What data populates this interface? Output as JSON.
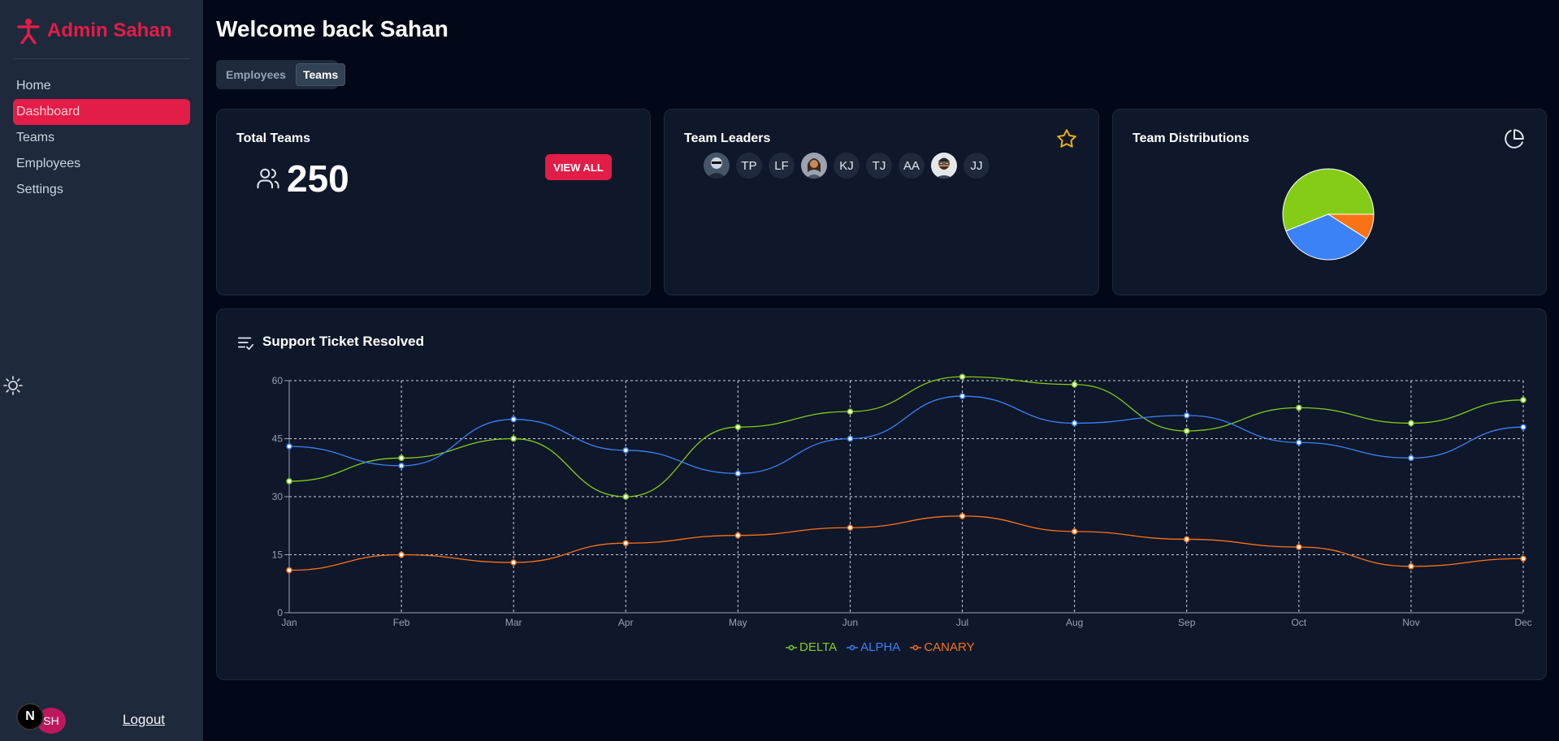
{
  "app": {
    "brand": "Admin Sahan",
    "page_title": "Welcome back Sahan"
  },
  "sidebar": {
    "items": [
      {
        "label": "Home",
        "active": false
      },
      {
        "label": "Dashboard",
        "active": true
      },
      {
        "label": "Teams",
        "active": false
      },
      {
        "label": "Employees",
        "active": false
      },
      {
        "label": "Settings",
        "active": false
      }
    ],
    "logout_label": "Logout",
    "next_badge": "N",
    "user_initials": "SH"
  },
  "tabs": [
    {
      "label": "Employees",
      "active": false
    },
    {
      "label": "Teams",
      "active": true
    }
  ],
  "cards": {
    "total_teams": {
      "title": "Total Teams",
      "value": "250",
      "button": "VIEW ALL"
    },
    "team_leaders": {
      "title": "Team Leaders",
      "avatars": [
        {
          "type": "photo",
          "label": ""
        },
        {
          "type": "initials",
          "label": "TP"
        },
        {
          "type": "initials",
          "label": "LF"
        },
        {
          "type": "photo",
          "label": ""
        },
        {
          "type": "initials",
          "label": "KJ"
        },
        {
          "type": "initials",
          "label": "TJ"
        },
        {
          "type": "initials",
          "label": "AA"
        },
        {
          "type": "photo",
          "label": ""
        },
        {
          "type": "initials",
          "label": "JJ"
        }
      ]
    },
    "team_distributions": {
      "title": "Team Distributions"
    },
    "support_tickets": {
      "title": "Support Ticket Resolved"
    }
  },
  "colors": {
    "accent": "#e11d48",
    "delta": "#84cc16",
    "alpha": "#3b82f6",
    "canary": "#f97316"
  },
  "chart_data": [
    {
      "type": "pie",
      "title": "",
      "series": [
        {
          "name": "DELTA",
          "value": 56
        },
        {
          "name": "ALPHA",
          "value": 35
        },
        {
          "name": "CANARY",
          "value": 9
        }
      ]
    },
    {
      "type": "line",
      "title": "",
      "categories": [
        "Jan",
        "Feb",
        "Mar",
        "Apr",
        "May",
        "Jun",
        "Jul",
        "Aug",
        "Sep",
        "Oct",
        "Nov",
        "Dec"
      ],
      "series": [
        {
          "name": "DELTA",
          "values": [
            34,
            40,
            45,
            30,
            48,
            52,
            61,
            59,
            47,
            53,
            49,
            55
          ]
        },
        {
          "name": "ALPHA",
          "values": [
            43,
            38,
            50,
            42,
            36,
            45,
            56,
            49,
            51,
            44,
            40,
            48
          ]
        },
        {
          "name": "CANARY",
          "values": [
            11,
            15,
            13,
            18,
            20,
            22,
            25,
            21,
            19,
            17,
            12,
            14
          ]
        }
      ],
      "yticks": [
        "0",
        "15",
        "30",
        "45",
        "60"
      ],
      "ylim": [
        0,
        60
      ],
      "grid": true,
      "legend": "bottom"
    }
  ]
}
